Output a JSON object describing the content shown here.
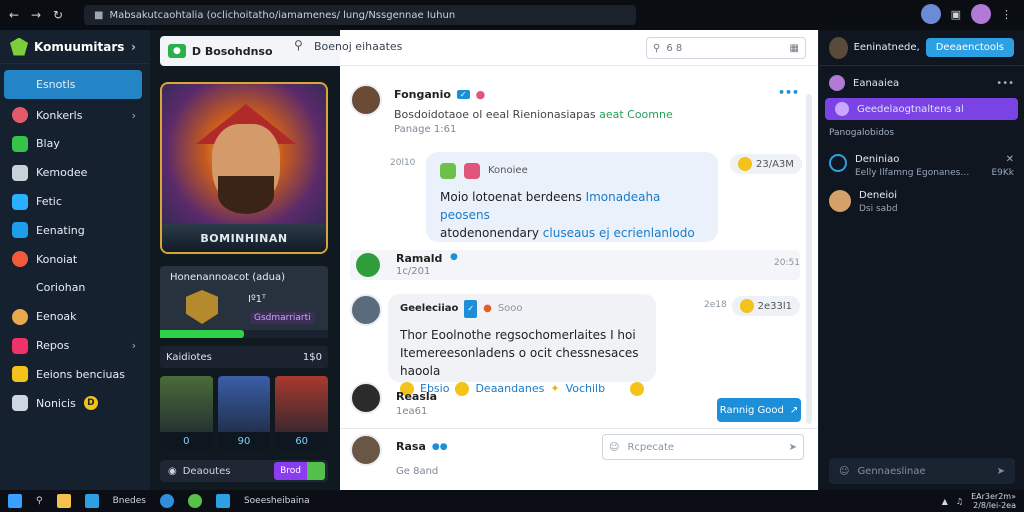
{
  "browser": {
    "url": "Mabsakutcaohtalia (oclichoitatho/iamamenes/ lung/Nssgennae Iuhun",
    "back_icon": "back-arrow-icon",
    "forward_icon": "forward-arrow-icon"
  },
  "sidebar": {
    "brand": "Komuumitars",
    "items": [
      {
        "label": "Esnotls",
        "icon": "home-icon",
        "color": "#2385c6",
        "active": true
      },
      {
        "label": "Konkerls",
        "icon": "profile-icon",
        "color": "#e35b6b",
        "chevron": true
      },
      {
        "label": "Blay",
        "icon": "play-icon",
        "color": "#35c34a"
      },
      {
        "label": "Kemodee",
        "icon": "settings-icon",
        "color": "#c8d0da"
      },
      {
        "label": "Fetic",
        "icon": "wand-icon",
        "color": "#2bb0ff"
      },
      {
        "label": "Eenating",
        "icon": "rocket-icon",
        "color": "#1e9dea"
      },
      {
        "label": "Konoiat",
        "icon": "globe-icon",
        "color": "#f05b3c"
      },
      {
        "label": "Coriohan",
        "icon": "",
        "color": ""
      },
      {
        "label": "Eenoak",
        "icon": "player-icon",
        "color": "#e9a84b"
      },
      {
        "label": "Repos",
        "icon": "heart-icon",
        "color": "#f0326a",
        "chevron": true
      },
      {
        "label": "Eeions benciuas",
        "icon": "badge-icon",
        "color": "#f3c21b"
      },
      {
        "label": "Nonicis",
        "icon": "bell-icon",
        "color": "#cfd6df",
        "badge": "D"
      }
    ]
  },
  "feature": {
    "header": "D Bosohdnso",
    "hero_banner": "BOMINHINAN",
    "card_title": "Honenannoacot (adua)",
    "card_line1": "Iº1ᵀ",
    "card_line2": "Gsdmarriarti",
    "card_progress": 0.5,
    "sub_title": "Kaidiotes",
    "sub_count": "1$0",
    "thumbs": [
      {
        "caption": "0",
        "color": "#4a6b3a"
      },
      {
        "caption": "90",
        "color": "#3b5ea8"
      },
      {
        "caption": "60",
        "color": "#a83a2d"
      }
    ],
    "footer_label": "Deaoutes",
    "footer_btn": "Brod"
  },
  "main": {
    "search_label": "Boenoj eihaates",
    "search_placeholder": "6 8",
    "posts": [
      {
        "name": "Fonganio",
        "text": "Bosdoidotaoe ol eeal Rienionasiapas",
        "link": "aeat Coomne",
        "meta": "Panage 1:61"
      },
      {
        "bubble_title": "Konoiee",
        "text": "Moio lotoenat berdeens",
        "link": "Imonadeaha peosens",
        "text2": "atodenonendary",
        "link2": "cluseaus ej ecrienlanlodo",
        "react": "23/A3M",
        "time": "20l10"
      },
      {
        "name": "Ramald",
        "meta": "1c/201",
        "time": "20:51"
      },
      {
        "name": "Geeleciiao",
        "tag": "Sooo",
        "text": "Thor Eoolnothe regsochomerlaites I hoi",
        "text2": "Itemereesonladens o ocit chessnesaces haoola",
        "link": "Ebsio",
        "link2": "Deaandanes",
        "link3": "Vochilb",
        "react": "2e33l1",
        "time": "2e18"
      },
      {
        "name": "Reasla",
        "meta": "1ea61"
      },
      {
        "name": "Rasa",
        "meta": "Ge 8and"
      }
    ],
    "reply_button": "Rannig Good",
    "compose_placeholder": "Rcpecate"
  },
  "right": {
    "title": "Eeninatnede,",
    "button": "Deeaenctools",
    "row1": "Eanaaiea",
    "row_active": "Geedelaogtnaltens al",
    "section": "Panogalobidos",
    "chats": [
      {
        "name": "Deniniao",
        "sub": "Eelly Ilfamng Egonanes…",
        "time": "E9Kk"
      },
      {
        "name": "Deneioi",
        "sub": "Dsi sabd"
      }
    ],
    "input_placeholder": "Gennaeslinae"
  },
  "taskbar": {
    "items": [
      "Bnedes",
      "Soeesheibaina"
    ],
    "time": "EAr3er2m»",
    "date": "2/8/Iei-2ea"
  },
  "colors": {
    "accent": "#2385c6",
    "purple": "#7b43e6",
    "green": "#2ed14a",
    "yellow": "#f3c21b"
  }
}
